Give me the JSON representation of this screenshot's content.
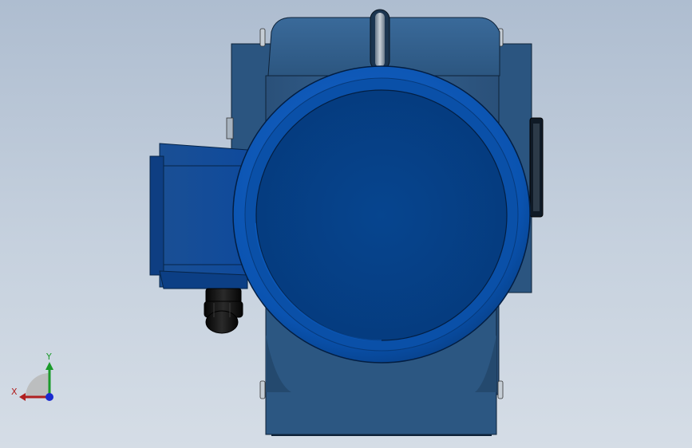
{
  "viewport": {
    "background_top": "#aebdd0",
    "background_bottom": "#d5dde6"
  },
  "model": {
    "body_color": "#2f5a86",
    "cover_color": "#063f86",
    "rim_color": "#0b56b5",
    "gland_color": "#111111"
  },
  "triad": {
    "x_label": "X",
    "y_label": "Y",
    "x_color": "#b02020",
    "y_color": "#1a9a2a",
    "z_color": "#1a2ad0"
  }
}
